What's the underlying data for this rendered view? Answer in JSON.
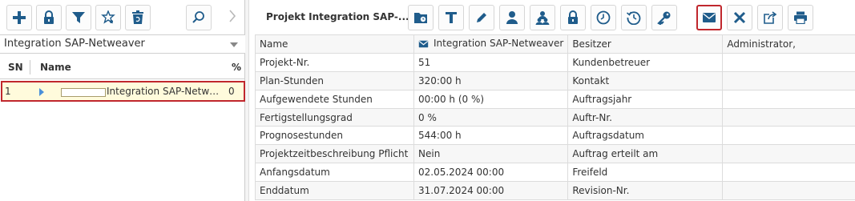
{
  "left_panel": {
    "toolbar": [
      {
        "name": "add-icon"
      },
      {
        "name": "lock-icon"
      },
      {
        "name": "filter-icon"
      },
      {
        "name": "star-filter-icon"
      },
      {
        "name": "recycle-bin-icon"
      },
      {
        "name": "search-icon"
      }
    ],
    "project_select": {
      "value": "Integration SAP-Netweaver"
    },
    "tree": {
      "columns": {
        "sn": "SN",
        "name": "Name",
        "percent": "%"
      },
      "rows": [
        {
          "sn": "1",
          "name": "Integration SAP-Netweaver",
          "percent": "0",
          "progress": 0
        }
      ]
    }
  },
  "right_panel": {
    "title": "Projekt Integration SAP-...",
    "toolbar": [
      {
        "name": "folder-clock-icon"
      },
      {
        "name": "text-icon"
      },
      {
        "name": "pencil-icon"
      },
      {
        "name": "person-icon"
      },
      {
        "name": "team-icon"
      },
      {
        "name": "lock-icon"
      },
      {
        "name": "clock-icon"
      },
      {
        "name": "history-icon"
      },
      {
        "name": "key-icon"
      },
      {
        "name": "mail-icon",
        "selected": true
      },
      {
        "name": "close-icon"
      },
      {
        "name": "share-icon"
      },
      {
        "name": "print-icon"
      }
    ],
    "accent_color": "#1f5c8b",
    "selection_color": "#c0272d",
    "fields": [
      {
        "label": "Name",
        "value": "Integration SAP-Netweaver",
        "label2": "Besitzer",
        "value2": "Administrator,"
      },
      {
        "label": "Projekt-Nr.",
        "value": "51",
        "label2": "Kundenbetreuer",
        "value2": ""
      },
      {
        "label": "Plan-Stunden",
        "value": "320:00 h",
        "label2": "Kontakt",
        "value2": ""
      },
      {
        "label": "Aufgewendete Stunden",
        "value": "00:00 h (0 %)",
        "label2": "Auftragsjahr",
        "value2": ""
      },
      {
        "label": "Fertigstellungsgrad",
        "value": "0 %",
        "label2": "Auftr-Nr.",
        "value2": ""
      },
      {
        "label": "Prognosestunden",
        "value": "544:00 h",
        "label2": "Auftragsdatum",
        "value2": ""
      },
      {
        "label": "Projektzeitbeschreibung Pflicht",
        "value": "Nein",
        "label2": "Auftrag erteilt am",
        "value2": ""
      },
      {
        "label": "Anfangsdatum",
        "value": "02.05.2024 00:00",
        "label2": "Freifeld",
        "value2": ""
      },
      {
        "label": "Enddatum",
        "value": "31.07.2024 00:00",
        "label2": "Revision-Nr.",
        "value2": ""
      }
    ]
  }
}
